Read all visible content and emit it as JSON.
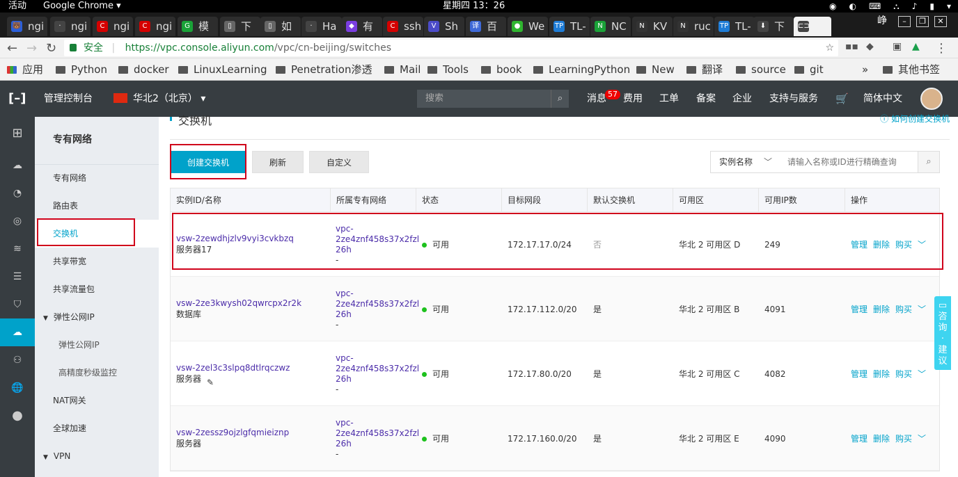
{
  "system": {
    "activities": "活动",
    "app": "Google Chrome ▾",
    "clock": "星期四 13：26"
  },
  "tabs": [
    {
      "label": "ngi",
      "icon": "🐻",
      "color": "#2b5fd9"
    },
    {
      "label": "ngi",
      "icon": "·",
      "color": "#444"
    },
    {
      "label": "ngi",
      "icon": "C",
      "color": "#d50000"
    },
    {
      "label": "ngi",
      "icon": "C",
      "color": "#d50000"
    },
    {
      "label": "模",
      "icon": "G",
      "color": "#1aa238"
    },
    {
      "label": "下",
      "icon": "▯",
      "color": "#666"
    },
    {
      "label": "如",
      "icon": "▯",
      "color": "#666"
    },
    {
      "label": "Ha",
      "icon": "·",
      "color": "#444"
    },
    {
      "label": "有",
      "icon": "◆",
      "color": "#7a3de0"
    },
    {
      "label": "ssh",
      "icon": "C",
      "color": "#d50000"
    },
    {
      "label": "Sh",
      "icon": "V",
      "color": "#4b4bc8"
    },
    {
      "label": "百",
      "icon": "译",
      "color": "#3f6ad8"
    },
    {
      "label": "We",
      "icon": "●",
      "color": "#2fb52f"
    },
    {
      "label": "TL-",
      "icon": "TP",
      "color": "#1e7cd6"
    },
    {
      "label": "NC",
      "icon": "N",
      "color": "#1aa238"
    },
    {
      "label": "KV",
      "icon": "N",
      "color": "#333"
    },
    {
      "label": "ruc",
      "icon": "N",
      "color": "#333"
    },
    {
      "label": "TL-",
      "icon": "TP",
      "color": "#1e7cd6"
    },
    {
      "label": "下",
      "icon": "⬇",
      "color": "#444"
    },
    {
      "label": "",
      "icon": "⊏⊐",
      "color": "#444"
    }
  ],
  "window_user": "峥",
  "address": {
    "secure": "安全",
    "host": "https://vpc.console.aliyun.com",
    "path": "/vpc/cn-beijing/switches"
  },
  "bookmarks": [
    "应用",
    "Python",
    "docker",
    "LinuxLearning",
    "Penetration渗透",
    "Mail",
    "Tools",
    "book",
    "LearningPython",
    "New",
    "翻译",
    "source",
    "git"
  ],
  "bookmarks_more": "»",
  "bookmarks_other": "其他书签",
  "header": {
    "console": "管理控制台",
    "region": "华北2（北京）",
    "search_placeholder": "搜索",
    "messages": "消息",
    "msg_count": "57",
    "nav": [
      "费用",
      "工单",
      "备案",
      "企业",
      "支持与服务"
    ],
    "lang": "简体中文"
  },
  "menu": {
    "title": "专有网络",
    "items": [
      {
        "label": "专有网络",
        "sub": false,
        "active": false,
        "caret": ""
      },
      {
        "label": "路由表",
        "sub": false,
        "active": false,
        "caret": ""
      },
      {
        "label": "交换机",
        "sub": false,
        "active": true,
        "caret": ""
      },
      {
        "label": "共享带宽",
        "sub": false,
        "active": false,
        "caret": ""
      },
      {
        "label": "共享流量包",
        "sub": false,
        "active": false,
        "caret": ""
      },
      {
        "label": "弹性公网IP",
        "sub": false,
        "active": false,
        "caret": "▼"
      },
      {
        "label": "弹性公网IP",
        "sub": true,
        "active": false,
        "caret": ""
      },
      {
        "label": "高精度秒级监控",
        "sub": true,
        "active": false,
        "caret": ""
      },
      {
        "label": "NAT网关",
        "sub": false,
        "active": false,
        "caret": ""
      },
      {
        "label": "全球加速",
        "sub": false,
        "active": false,
        "caret": ""
      },
      {
        "label": "VPN",
        "sub": false,
        "active": false,
        "caret": "▼"
      }
    ]
  },
  "page": {
    "title": "交换机",
    "link": "如何创建交换机"
  },
  "toolbar": {
    "create": "创建交换机",
    "refresh": "刷新",
    "customize": "自定义",
    "select": "实例名称",
    "query_placeholder": "请输入名称或ID进行精确查询"
  },
  "table": {
    "headers": [
      "实例ID/名称",
      "所属专有网络",
      "状态",
      "目标网段",
      "默认交换机",
      "可用区",
      "可用IP数",
      "操作"
    ],
    "rows": [
      {
        "id": "vsw-2zewdhjzlv9vyi3cvkbzq",
        "name": "服务器17",
        "vpc1": "vpc-",
        "vpc2": "2ze4znf458s37x2fzl",
        "vpc3": "26h",
        "vpc4": "-",
        "status": "可用",
        "cidr": "172.17.17.0/24",
        "default": "否",
        "zone": "华北 2 可用区 D",
        "ips": "249"
      },
      {
        "id": "vsw-2ze3kwysh02qwrcpx2r2k",
        "name": "数据库",
        "vpc1": "vpc-",
        "vpc2": "2ze4znf458s37x2fzl",
        "vpc3": "26h",
        "vpc4": "-",
        "status": "可用",
        "cidr": "172.17.112.0/20",
        "default": "是",
        "zone": "华北 2 可用区 B",
        "ips": "4091"
      },
      {
        "id": "vsw-2zel3c3slpq8dtlrqczwz",
        "name": "服务器",
        "vpc1": "vpc-",
        "vpc2": "2ze4znf458s37x2fzl",
        "vpc3": "26h",
        "vpc4": "-",
        "status": "可用",
        "cidr": "172.17.80.0/20",
        "default": "是",
        "zone": "华北 2 可用区 C",
        "ips": "4082"
      },
      {
        "id": "vsw-2zessz9ojzlgfqmieiznp",
        "name": "服务器",
        "vpc1": "vpc-",
        "vpc2": "2ze4znf458s37x2fzl",
        "vpc3": "26h",
        "vpc4": "-",
        "status": "可用",
        "cidr": "172.17.160.0/20",
        "default": "是",
        "zone": "华北 2 可用区 E",
        "ips": "4090"
      }
    ],
    "ops": {
      "manage": "管理",
      "delete": "删除",
      "buy": "购买"
    }
  },
  "consult": "咨询·建议",
  "colors": {
    "accent": "#00a2ca",
    "header": "#373d41",
    "available": "#1dc11d",
    "highlight": "#d0021b"
  }
}
